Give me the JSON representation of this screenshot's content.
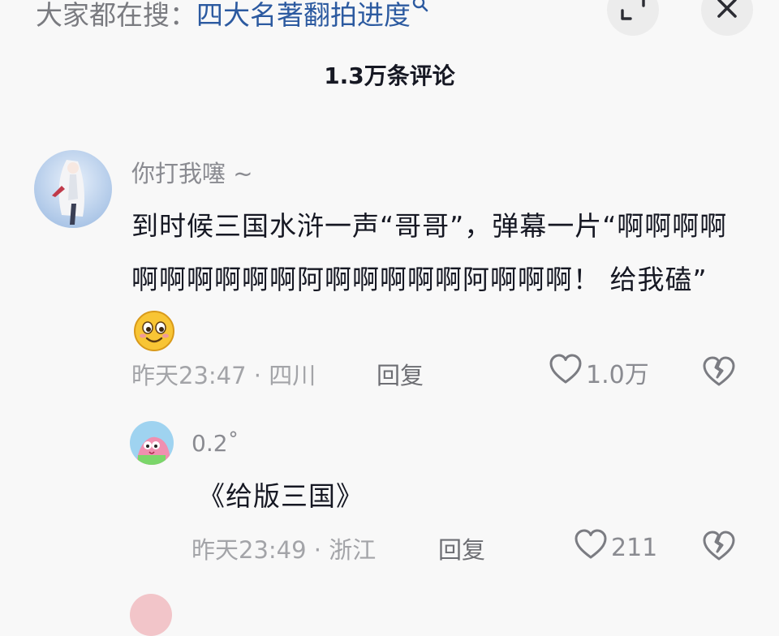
{
  "search_bar": {
    "prefix": "大家都在搜：",
    "term": "四大名著翻拍进度",
    "icon": "search-icon"
  },
  "header": {
    "comment_count": "1.3万条评论",
    "expand_icon": "expand-icon",
    "close_icon": "close-icon"
  },
  "comments": [
    {
      "username": "你打我噻 ~",
      "text": "到时候三国水浒一声“哥哥”，弹幕一片“啊啊啊啊啊啊啊啊啊啊阿啊啊啊啊啊阿啊啊啊！ 给我磕”",
      "emoji": "smiling-emoji",
      "meta": "昨天23:47 · 四川",
      "reply_label": "回复",
      "like_count": "1.0万"
    }
  ],
  "replies": [
    {
      "username": "0.2˚",
      "text": "《给版三国》",
      "meta": "昨天23:49 · 浙江",
      "reply_label": "回复",
      "like_count": "211"
    }
  ],
  "colors": {
    "background": "#f8f8f8",
    "link_blue": "#2c5aa0",
    "text_primary": "#161823",
    "text_secondary": "#8a8b91"
  }
}
